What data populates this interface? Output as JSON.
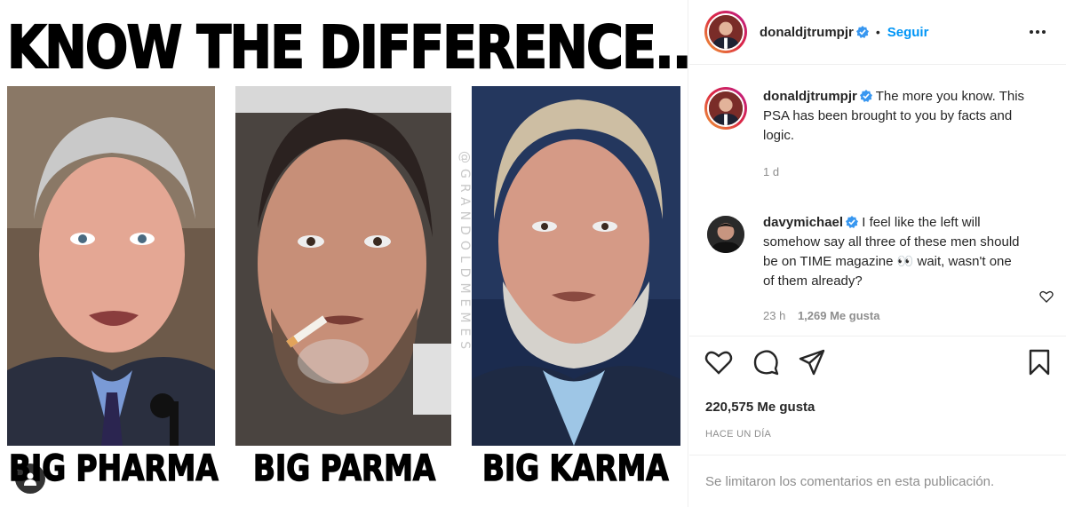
{
  "meme": {
    "title": "KNOW THE DIFFERENCE...",
    "watermark": "@GRANDOLDMEMES",
    "captions": [
      "BIG PHARMA",
      "BIG PARMA",
      "BIG KARMA"
    ]
  },
  "header": {
    "username": "donaldjtrumpjr",
    "separator": "•",
    "follow_label": "Seguir",
    "more_icon": "more-options-icon"
  },
  "caption_comment": {
    "username": "donaldjtrumpjr",
    "text": "The more you know. This PSA has been brought to you by facts and logic.",
    "time": "1 d"
  },
  "reply_comment": {
    "username": "davymichael",
    "text": "I feel like the left will somehow say all three of these men should be on TIME magazine 👀 wait, wasn't one of them already?",
    "time": "23 h",
    "likes": "1,269 Me gusta"
  },
  "actions": {
    "icons": [
      "heart-icon",
      "comment-icon",
      "share-icon",
      "bookmark-icon"
    ]
  },
  "stats": {
    "likes": "220,575 Me gusta",
    "posted": "HACE UN DÍA"
  },
  "footer": {
    "comments_limited": "Se limitaron los comentarios en esta publicación."
  },
  "colors": {
    "accent": "#0095f6",
    "verified": "#3897f0",
    "muted": "#8e8e8e",
    "text": "#262626"
  }
}
